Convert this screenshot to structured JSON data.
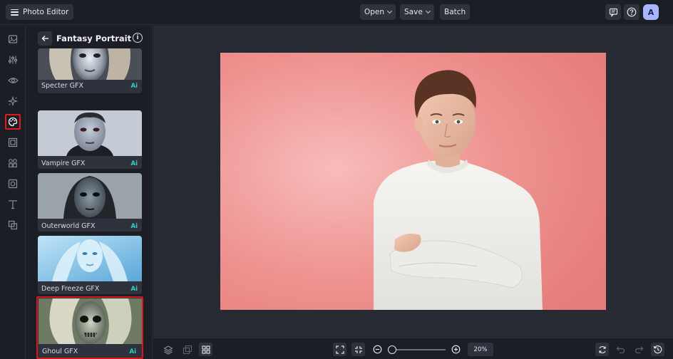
{
  "topbar": {
    "app_title": "Photo Editor",
    "open_label": "Open",
    "save_label": "Save",
    "batch_label": "Batch",
    "avatar_letter": "A"
  },
  "rail": {
    "items": [
      "image-icon",
      "adjust-icon",
      "eye-icon",
      "sparkle-icon",
      "palette-icon",
      "frame-icon",
      "elements-icon",
      "texture-icon",
      "text-icon",
      "overlay-icon"
    ],
    "active": "palette-icon"
  },
  "panel": {
    "title": "Fantasy Portrait",
    "effects": [
      {
        "label": "Specter GFX",
        "badge": "Ai"
      },
      {
        "label": "Vampire GFX",
        "badge": "Ai"
      },
      {
        "label": "Outerworld GFX",
        "badge": "Ai"
      },
      {
        "label": "Deep Freeze GFX",
        "badge": "Ai"
      },
      {
        "label": "Ghoul GFX",
        "badge": "Ai"
      }
    ],
    "selected": "Ghoul GFX"
  },
  "bottombar": {
    "zoom_label": "20%",
    "zoom_level": 0.2
  },
  "colors": {
    "background": "#1c1e26",
    "workspace": "#272a33",
    "button": "#2f323d",
    "accent_ai": "#2fd3c4",
    "highlight": "#d9151e",
    "avatar": "#a9b5ff",
    "photo_background": "#ee8e8a"
  }
}
